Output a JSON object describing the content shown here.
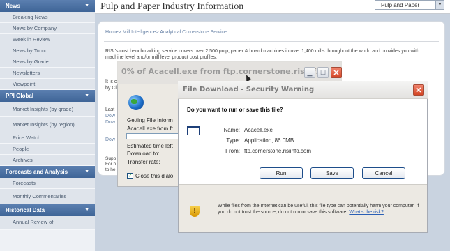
{
  "sidebar": {
    "news_header": "News",
    "news_items": [
      "Breaking News",
      "News by Company",
      "Week in Review",
      "News by Topic",
      "News by Grade",
      "Newsletters",
      "Viewpoint"
    ],
    "ppi_header": "PPI Global",
    "ppi_items": [
      "Market Insights (by grade)",
      "Market Insights (by region)",
      "Price Watch",
      "People",
      "Archives"
    ],
    "forecasts_header": "Forecasts and Analysis",
    "forecasts_items": [
      "Forecasts",
      "Monthly Commentaries"
    ],
    "historical_header": "Historical Data",
    "historical_items": [
      "Annual Review of"
    ]
  },
  "main": {
    "page_title": "Pulp and Paper Industry Information",
    "region_select": "Pulp and Paper",
    "breadcrumb": "Home> Mill Intelligence> Analytical Cornerstone Service",
    "intro": "RISI's cost benchmarking service covers over 2,500 pulp, paper & board machines in over 1,400 mills throughout the world and provides you with machine level and/or mill level product cost profiles.",
    "intro2_line1": "It is c",
    "intro2_line2": "by Cl",
    "last_label": "Last",
    "dow1": "Dow",
    "dow2": "Dow",
    "dow3": "Dow",
    "supp1": "Supp",
    "supp2": "For h",
    "supp3": "to he"
  },
  "progress_dialog": {
    "title": "0% of Acacell.exe from ftp.cornerstone.risinf...",
    "getting_info": "Getting File Inform",
    "file_from": "Acacell.exe from ft",
    "estimated": "Estimated time left",
    "download_to": "Download to:",
    "transfer_rate": "Transfer rate:",
    "close_label": "Close this dialo",
    "progress": 0
  },
  "security_dialog": {
    "title": "File Download - Security Warning",
    "question": "Do you want to run or save this file?",
    "name_label": "Name:",
    "name_value": "Acacell.exe",
    "type_label": "Type:",
    "type_value": "Application, 86.0MB",
    "from_label": "From:",
    "from_value": "ftp.cornerstone.risiinfo.com",
    "run_button": "Run",
    "save_button": "Save",
    "cancel_button": "Cancel",
    "note": "While files from the Internet can be useful, this file type can potentially harm your computer. If you do not trust the source, do not run or save this software.",
    "note_link": "What's the risk?"
  },
  "icons": [
    "globe-icon",
    "file-icon",
    "shield-warning-icon",
    "close-icon",
    "minimize-icon",
    "maximize-icon",
    "dropdown-arrow-icon",
    "checkmark-icon"
  ]
}
